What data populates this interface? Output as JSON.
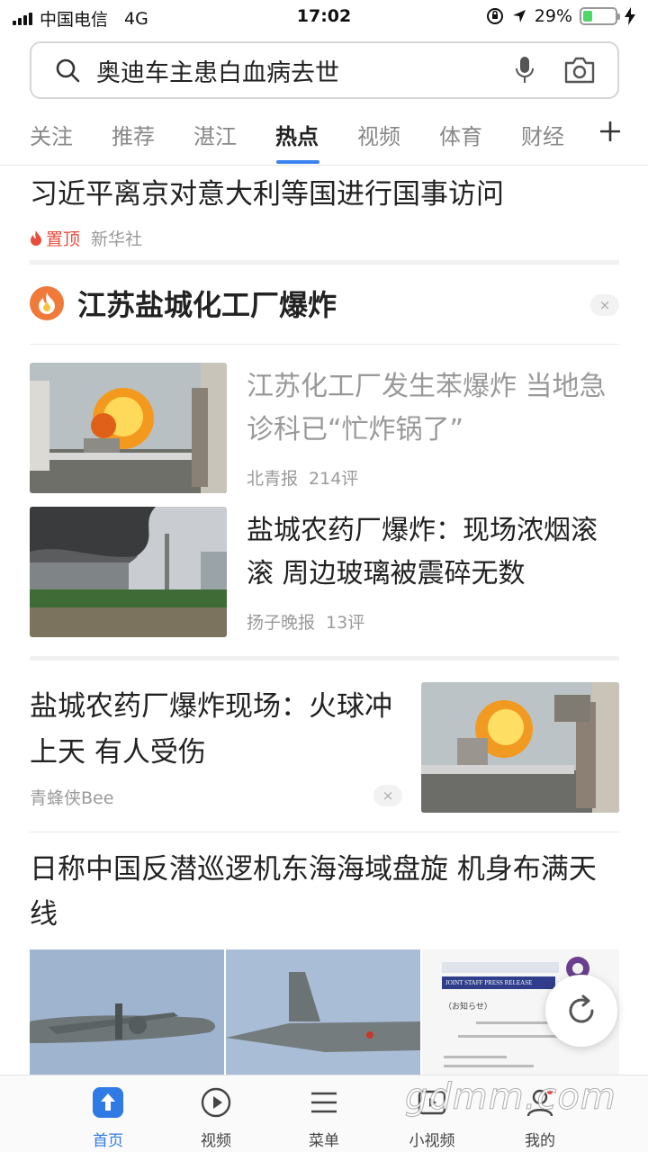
{
  "status_bar": {
    "carrier": "中国电信",
    "network": "4G",
    "time": "17:02",
    "battery": "29%",
    "battery_level": 0.29
  },
  "search": {
    "query": "奥迪车主患白血病去世"
  },
  "tabs": [
    {
      "label": "关注"
    },
    {
      "label": "推荐"
    },
    {
      "label": "湛江"
    },
    {
      "label": "热点",
      "active": true
    },
    {
      "label": "视频"
    },
    {
      "label": "体育"
    },
    {
      "label": "财经"
    }
  ],
  "articles": {
    "pinned": {
      "title": "习近平离京对意大利等国进行国事访问",
      "pin_label": "置顶",
      "source": "新华社"
    },
    "topic": {
      "title": "江苏盐城化工厂爆炸",
      "close": "×",
      "items": [
        {
          "title": "江苏化工厂发生苯爆炸 当地急诊科已“忙炸锅了”",
          "source": "北青报",
          "comments": "214评"
        },
        {
          "title": "盐城农药厂爆炸：现场浓烟滚滚 周边玻璃被震碎无数",
          "source": "扬子晚报",
          "comments": "13评"
        }
      ]
    },
    "single": {
      "title": "盐城农药厂爆炸现场：火球冲上天 有人受伤",
      "source": "青蜂侠Bee",
      "close": "×"
    },
    "gallery": {
      "title": "日称中国反潜巡逻机东海海域盘旋 机身布满天线",
      "doc_header": "JOINT STAFF PRESS RELEASE",
      "doc_line": "（お知らせ）"
    }
  },
  "bottom_nav": [
    {
      "label": "首页",
      "icon": "home-upload-icon",
      "active": true
    },
    {
      "label": "视频",
      "icon": "play-circle-icon"
    },
    {
      "label": "菜单",
      "icon": "menu-icon"
    },
    {
      "label": "小视频",
      "icon": "mini-video-icon"
    },
    {
      "label": "我的",
      "icon": "profile-icon"
    }
  ],
  "watermark": "gdmm.com",
  "colors": {
    "accent": "#3b83f0",
    "pin_red": "#e74c3c",
    "topic_orange": "#f07a3a",
    "battery_green": "#4cd964"
  }
}
